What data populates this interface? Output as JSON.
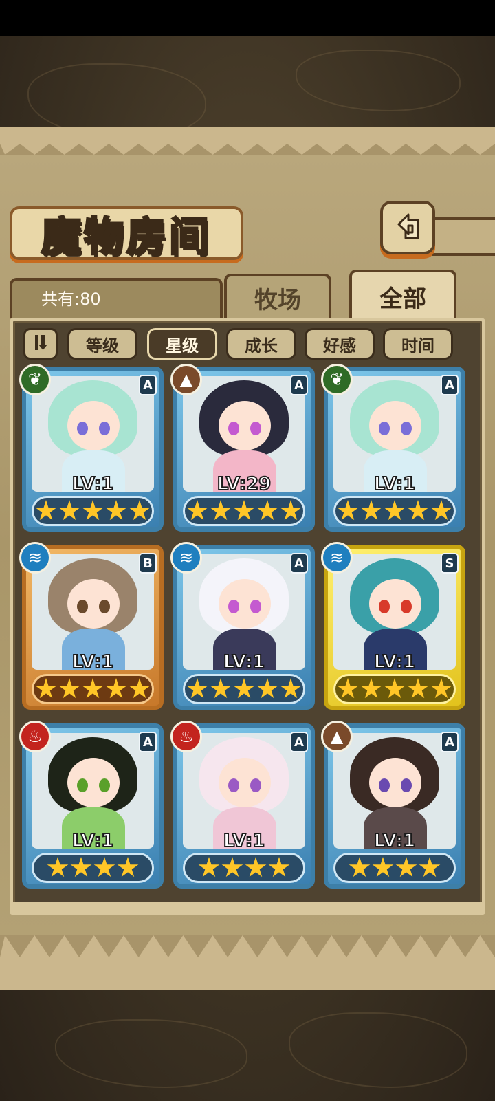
{
  "header": {
    "title": "魔物房间",
    "back_icon": "return-arrow-icon"
  },
  "tabs": [
    {
      "label": "牧场",
      "selected": false
    },
    {
      "label": "全部",
      "selected": true
    }
  ],
  "count_label": "共有:80",
  "sort_bar": {
    "toggle_icon": "sort-order-icon",
    "buttons": [
      {
        "label": "等级",
        "active": false
      },
      {
        "label": "星级",
        "active": true
      },
      {
        "label": "成长",
        "active": false
      },
      {
        "label": "好感",
        "active": false
      },
      {
        "label": "时间",
        "active": false
      }
    ]
  },
  "monsters": [
    {
      "level": "LV:1",
      "rank": "A",
      "element": "leaf",
      "element_color": "#2f6b26",
      "stars": 5,
      "hair": "#a8e4d2",
      "outfit": "#d8eef5",
      "eye": "#7a6ed8"
    },
    {
      "level": "LV:29",
      "rank": "A",
      "element": "earth",
      "element_color": "#7a4a2a",
      "stars": 5,
      "hair": "#2a2a3c",
      "outfit": "#f3b6c8",
      "eye": "#c45ad0"
    },
    {
      "level": "LV:1",
      "rank": "A",
      "element": "leaf",
      "element_color": "#2f6b26",
      "stars": 5,
      "hair": "#a8e4d2",
      "outfit": "#d8eef5",
      "eye": "#7a6ed8"
    },
    {
      "level": "LV:1",
      "rank": "B",
      "element": "water",
      "element_color": "#1f7fbf",
      "stars": 5,
      "hair": "#9a836b",
      "outfit": "#7ab0dc",
      "eye": "#6b4a2c"
    },
    {
      "level": "LV:1",
      "rank": "A",
      "element": "water",
      "element_color": "#1f7fbf",
      "stars": 5,
      "hair": "#f4f4fa",
      "outfit": "#3a3a5a",
      "eye": "#c45ad0"
    },
    {
      "level": "LV:1",
      "rank": "S",
      "element": "water",
      "element_color": "#1f7fbf",
      "stars": 5,
      "hair": "#3aa0a8",
      "outfit": "#2a3a6a",
      "eye": "#d83a2a"
    },
    {
      "level": "LV:1",
      "rank": "A",
      "element": "fire",
      "element_color": "#c3241e",
      "stars": 4,
      "hair": "#1e2418",
      "outfit": "#8ccd6a",
      "eye": "#5aa02a"
    },
    {
      "level": "LV:1",
      "rank": "A",
      "element": "fire",
      "element_color": "#c3241e",
      "stars": 4,
      "hair": "#f6e6ee",
      "outfit": "#f0c6d6",
      "eye": "#9a5ac4"
    },
    {
      "level": "LV:1",
      "rank": "A",
      "element": "earth",
      "element_color": "#7a4a2a",
      "stars": 4,
      "hair": "#3a2a24",
      "outfit": "#5a4a4a",
      "eye": "#6a4ab0"
    }
  ]
}
